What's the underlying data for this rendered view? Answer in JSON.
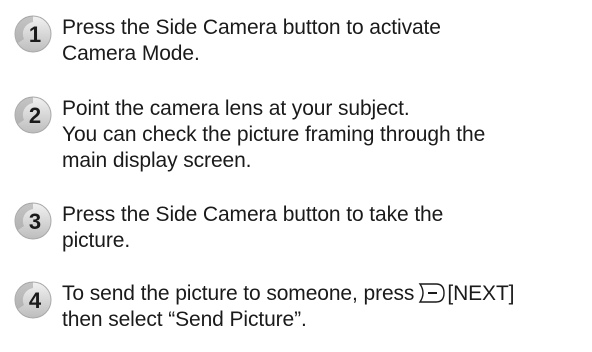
{
  "steps": [
    {
      "number": "1",
      "lines": [
        "Press the Side Camera button to activate",
        "Camera Mode."
      ]
    },
    {
      "number": "2",
      "lines": [
        "Point the camera lens at your subject.",
        "You can check the picture framing through the",
        "main display screen."
      ]
    },
    {
      "number": "3",
      "lines": [
        "Press the Side Camera button to take the",
        "picture."
      ]
    },
    {
      "number": "4",
      "line1_before_icon": "To send the picture to someone, press",
      "soft_key_icon": "right-soft-key-icon",
      "line1_after_icon": "[NEXT]",
      "line2": "then select “Send Picture”."
    }
  ]
}
